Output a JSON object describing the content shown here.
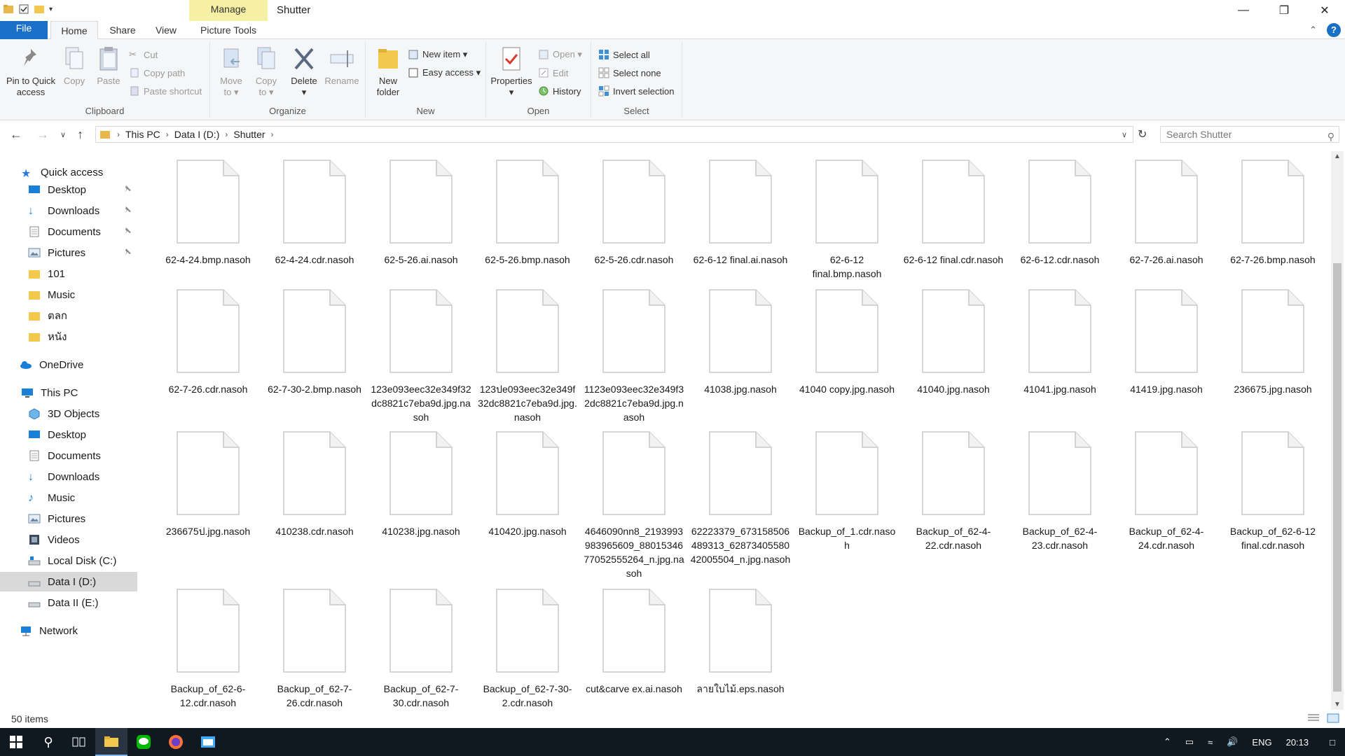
{
  "window": {
    "title": "Shutter",
    "manage_tab": "Manage",
    "controls": [
      "minimize",
      "restore",
      "close"
    ]
  },
  "ribbon_tabs": {
    "file": "File",
    "home": "Home",
    "share": "Share",
    "view": "View",
    "picture_tools": "Picture Tools"
  },
  "ribbon": {
    "clipboard": {
      "name": "Clipboard",
      "pin": "Pin to Quick\naccess",
      "copy": "Copy",
      "paste": "Paste",
      "cut": "Cut",
      "copy_path": "Copy path",
      "paste_shortcut": "Paste shortcut"
    },
    "organize": {
      "name": "Organize",
      "move_to": "Move\nto ▾",
      "copy_to": "Copy\nto ▾",
      "delete": "Delete\n▾",
      "rename": "Rename"
    },
    "new": {
      "name": "New",
      "new_folder": "New\nfolder",
      "new_item": "New item ▾",
      "easy_access": "Easy access ▾"
    },
    "open": {
      "name": "Open",
      "properties": "Properties\n▾",
      "open": "Open ▾",
      "edit": "Edit",
      "history": "History"
    },
    "select": {
      "name": "Select",
      "select_all": "Select all",
      "select_none": "Select none",
      "invert": "Invert selection"
    }
  },
  "address": {
    "crumbs": [
      "This PC",
      "Data I (D:)",
      "Shutter"
    ],
    "search_placeholder": "Search Shutter"
  },
  "nav": {
    "quick_access": "Quick access",
    "quick_items": [
      "Desktop",
      "Downloads",
      "Documents",
      "Pictures",
      "101",
      "Music",
      "ตลก",
      "หนัง"
    ],
    "onedrive": "OneDrive",
    "this_pc": "This PC",
    "pc_items": [
      "3D Objects",
      "Desktop",
      "Documents",
      "Downloads",
      "Music",
      "Pictures",
      "Videos",
      "Local Disk (C:)",
      "Data I (D:)",
      "Data II (E:)"
    ],
    "network": "Network"
  },
  "files": [
    "62-4-24.bmp.nasoh",
    "62-4-24.cdr.nasoh",
    "62-5-26.ai.nasoh",
    "62-5-26.bmp.nasoh",
    "62-5-26.cdr.nasoh",
    "62-6-12 final.ai.nasoh",
    "62-6-12 final.bmp.nasoh",
    "62-6-12 final.cdr.nasoh",
    "62-6-12.cdr.nasoh",
    "62-7-26.ai.nasoh",
    "62-7-26.bmp.nasoh",
    "62-7-26.cdr.nasoh",
    "62-7-30-2.bmp.nasoh",
    "123e093eec32e349f32dc8821c7eba9d.jpg.nasoh",
    "123ปe093eec32e349f32dc8821c7eba9d.jpg.nasoh",
    "1123e093eec32e349f32dc8821c7eba9d.jpg.nasoh",
    "41038.jpg.nasoh",
    "41040 copy.jpg.nasoh",
    "41040.jpg.nasoh",
    "41041.jpg.nasoh",
    "41419.jpg.nasoh",
    "236675.jpg.nasoh",
    "236675ป.jpg.nasoh",
    "410238.cdr.nasoh",
    "410238.jpg.nasoh",
    "410420.jpg.nasoh",
    "4646090nn8_2193993983965609_8801534677052555264_n.jpg.nasoh",
    "62223379_673158506489313_6287340558042005504_n.jpg.nasoh",
    "Backup_of_1.cdr.nasoh",
    "Backup_of_62-4-22.cdr.nasoh",
    "Backup_of_62-4-23.cdr.nasoh",
    "Backup_of_62-4-24.cdr.nasoh",
    "Backup_of_62-6-12 final.cdr.nasoh",
    "Backup_of_62-6-12.cdr.nasoh",
    "Backup_of_62-7-26.cdr.nasoh",
    "Backup_of_62-7-30.cdr.nasoh",
    "Backup_of_62-7-30-2.cdr.nasoh",
    "cut&carve ex.ai.nasoh",
    "ลายใบไม้.eps.nasoh"
  ],
  "status": {
    "item_count": "50 items"
  },
  "taskbar": {
    "lang": "ENG",
    "time": "20:13"
  }
}
